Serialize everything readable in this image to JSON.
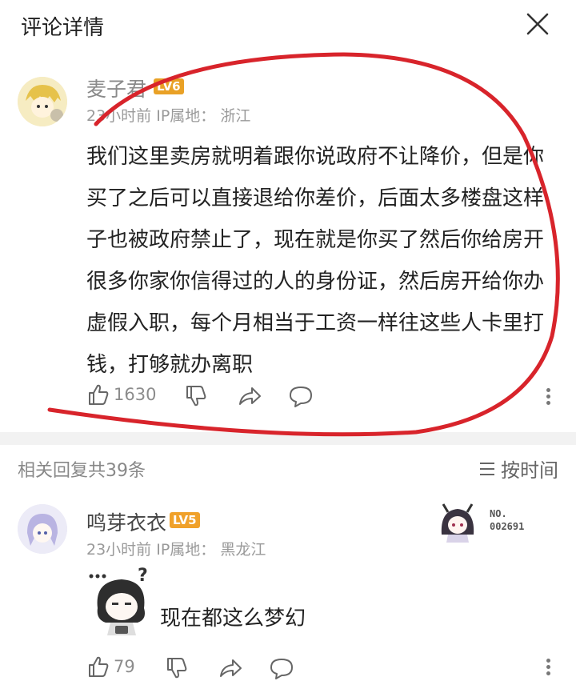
{
  "header": {
    "title": "评论详情"
  },
  "comment": {
    "username": "麦子君",
    "level": "LV6",
    "time": "23小时前",
    "location_label": "IP属地：",
    "location": "浙江",
    "text": "我们这里卖房就明着跟你说政府不让降价，但是你买了之后可以直接退给你差价，后面太多楼盘这样子也被政府禁止了，现在就是你买了然后你给房开很多你家你信得过的人的身份证，然后房开给你办虚假入职，每个月相当于工资一样往这些人卡里打钱，打够就办离职",
    "likes": "1630"
  },
  "replies": {
    "header": "相关回复共39条",
    "sort_label": "按时间"
  },
  "reply": {
    "username": "鸣芽衣衣",
    "level": "LV5",
    "badge_line1": "NO.",
    "badge_line2": "002691",
    "time": "23小时前",
    "location_label": "IP属地：",
    "location": "黑龙江",
    "text": "现在都这么梦幻",
    "likes": "79"
  },
  "colors": {
    "annotation_circle": "#d8242b",
    "level_badge": "#f0a12a",
    "muted_text": "#8c8c8c"
  },
  "icons": [
    "close-icon",
    "like-icon",
    "dislike-icon",
    "share-icon",
    "comment-icon",
    "more-icon",
    "sort-icon"
  ]
}
